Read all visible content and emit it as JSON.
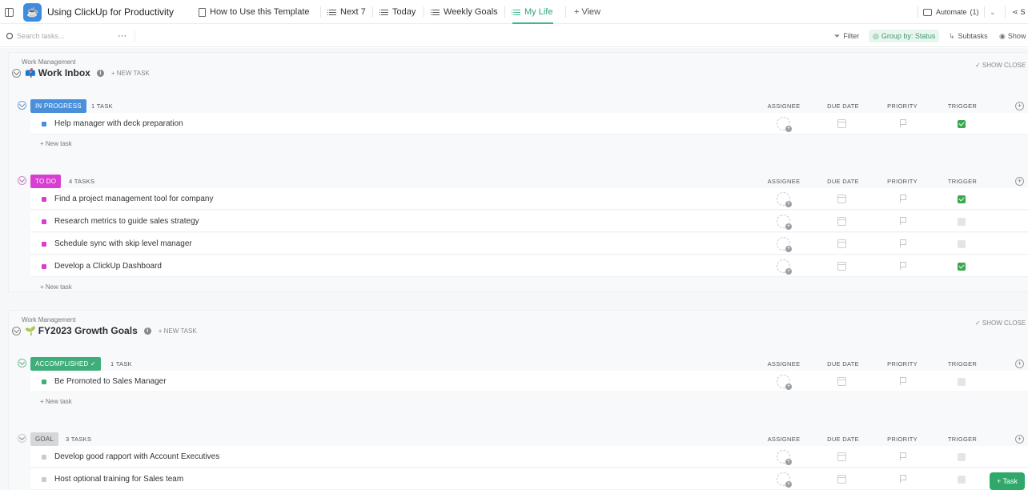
{
  "header": {
    "title": "Using ClickUp for Productivity",
    "tabs": [
      {
        "label": "How to Use this Template"
      },
      {
        "label": "Next 7"
      },
      {
        "label": "Today"
      },
      {
        "label": "Weekly Goals"
      },
      {
        "label": "My Life"
      }
    ],
    "add_view": "+ View",
    "automate": "Automate",
    "automate_count": "(1)",
    "share": "S"
  },
  "toolbar": {
    "search_placeholder": "Search tasks...",
    "more": "···",
    "filter": "Filter",
    "group_by": "Group by: Status",
    "subtasks": "Subtasks",
    "show": "Show"
  },
  "columns": {
    "assignee": "ASSIGNEE",
    "due_date": "DUE DATE",
    "priority": "PRIORITY",
    "trigger": "TRIGGER"
  },
  "lists": [
    {
      "section": "Work Management",
      "emoji": "📫",
      "name": "Work Inbox",
      "new_task": "+ NEW TASK",
      "show_closed": "✓ SHOW CLOSE",
      "groups": [
        {
          "status": "IN PROGRESS",
          "color": "#4a8fd9",
          "count": "1 TASK",
          "tasks": [
            {
              "name": "Help manager with deck preparation",
              "trigger": true
            }
          ],
          "new_task": "+ New task"
        },
        {
          "status": "TO DO",
          "color": "#d63fd1",
          "count": "4 TASKS",
          "tasks": [
            {
              "name": "Find a project management tool for company",
              "trigger": true
            },
            {
              "name": "Research metrics to guide sales strategy",
              "trigger": false
            },
            {
              "name": "Schedule sync with skip level manager",
              "trigger": false
            },
            {
              "name": "Develop a ClickUp Dashboard",
              "trigger": true
            }
          ],
          "new_task": "+ New task"
        }
      ]
    },
    {
      "section": "Work Management",
      "emoji": "🌱",
      "name": "FY2023 Growth Goals",
      "new_task": "+ NEW TASK",
      "show_closed": "✓ SHOW CLOSE",
      "groups": [
        {
          "status": "ACCOMPLISHED ✓",
          "color": "#3fae7a",
          "count": "1 TASK",
          "tasks": [
            {
              "name": "Be Promoted to Sales Manager",
              "trigger": false
            }
          ],
          "new_task": "+ New task"
        },
        {
          "status": "GOAL",
          "color": "#c7c9cc",
          "count": "3 TASKS",
          "tasks": [
            {
              "name": "Develop good rapport with Account Executives",
              "trigger": false
            },
            {
              "name": "Host optional training for Sales team",
              "trigger": false
            }
          ]
        }
      ]
    }
  ],
  "fab": "+ Task"
}
